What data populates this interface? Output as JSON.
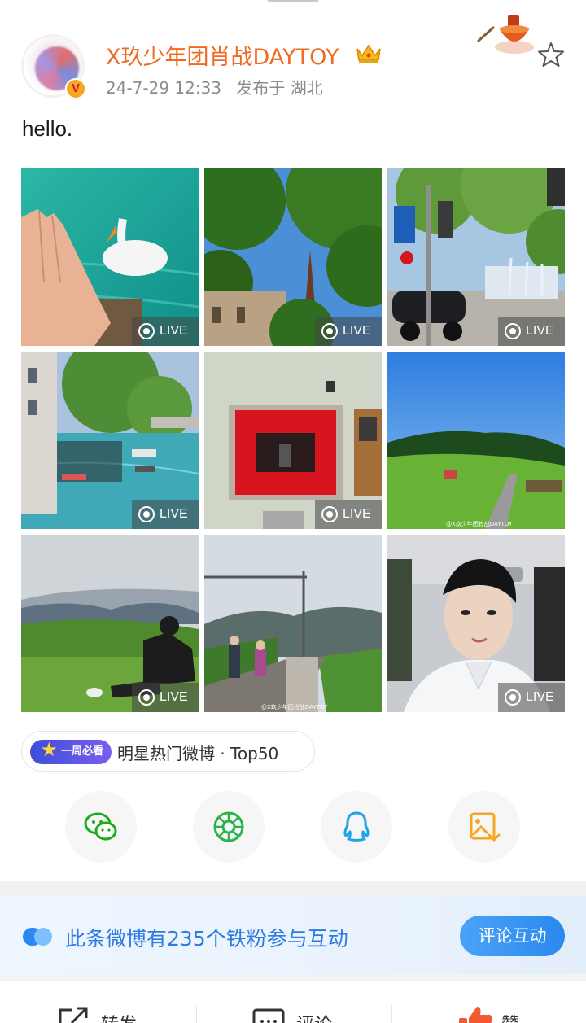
{
  "post": {
    "username": "X玖少年团肖战DAYTOY",
    "timestamp": "24-7-29 12:33",
    "source": "发布于 湖北",
    "text": "hello.",
    "verified_mark": "V",
    "crown_icon": "crown-icon",
    "favorite_icon": "star-outline-icon"
  },
  "photos": [
    {
      "id": "swan-lake",
      "live": true,
      "live_label": "LIVE"
    },
    {
      "id": "tree-spire",
      "live": true,
      "live_label": "LIVE"
    },
    {
      "id": "street-fountain",
      "live": true,
      "live_label": "LIVE"
    },
    {
      "id": "canal-boats",
      "live": true,
      "live_label": "LIVE"
    },
    {
      "id": "red-window",
      "live": true,
      "live_label": "LIVE"
    },
    {
      "id": "green-valley",
      "live": false,
      "watermark": "@X玖少年团肖战DAYTOY"
    },
    {
      "id": "hillside-sitting",
      "live": true,
      "live_label": "LIVE"
    },
    {
      "id": "railway-mountains",
      "live": false,
      "watermark": "@X玖少年团肖战DAYTOY"
    },
    {
      "id": "car-selfie",
      "live": true,
      "live_label": "LIVE"
    }
  ],
  "tag": {
    "badge": "一周必看",
    "text": "明星热门微博 · Top50"
  },
  "share": [
    {
      "name": "wechat-icon",
      "color": "#1aad19"
    },
    {
      "name": "moments-icon",
      "color": "#2bb34a"
    },
    {
      "name": "qq-icon",
      "color": "#1fa3e8"
    },
    {
      "name": "save-image-icon",
      "color": "#f5a623"
    }
  ],
  "fan_bar": {
    "text": "此条微博有235个铁粉参与互动",
    "button": "评论互动"
  },
  "actions": {
    "repost": "转发",
    "comment": "评论",
    "like": "赞"
  },
  "colors": {
    "username": "#f06b21",
    "accent_blue": "#2b88ef",
    "meta_gray": "#8c8c8c"
  }
}
